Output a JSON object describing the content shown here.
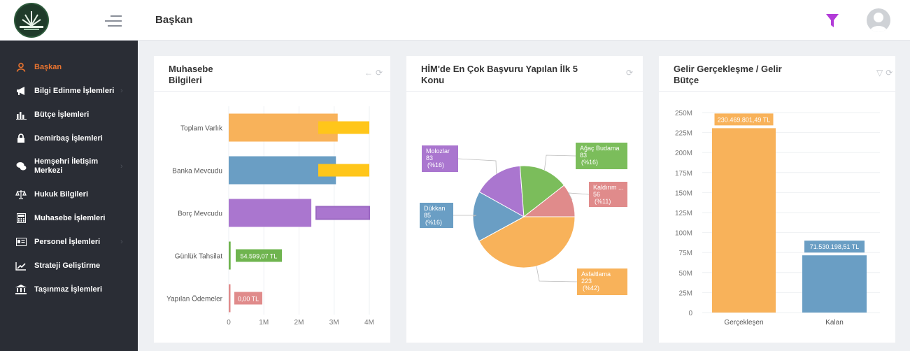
{
  "header": {
    "title": "Başkan"
  },
  "sidebar": {
    "items": [
      {
        "label": "Başkan",
        "icon": "user-icon"
      },
      {
        "label": "Bilgi Edinme İşlemleri",
        "icon": "megaphone-icon"
      },
      {
        "label": "Bütçe İşlemleri",
        "icon": "bar-chart-icon"
      },
      {
        "label": "Demirbaş İşlemleri",
        "icon": "lock-icon"
      },
      {
        "label": "Hemşehri İletişim Merkezi",
        "icon": "chat-icon"
      },
      {
        "label": "Hukuk Bilgileri",
        "icon": "scale-icon"
      },
      {
        "label": "Muhasebe İşlemleri",
        "icon": "calculator-icon"
      },
      {
        "label": "Personel İşlemleri",
        "icon": "id-card-icon"
      },
      {
        "label": "Strateji Geliştirme",
        "icon": "line-chart-icon"
      },
      {
        "label": "Taşınmaz İşlemleri",
        "icon": "bank-icon"
      }
    ]
  },
  "cards": {
    "accounting": {
      "title_line1": "Muhasebe",
      "title_line2": "Bilgileri"
    },
    "applications": {
      "title_line1": "HİM'de En Çok Başvuru Yapılan İlk 5",
      "title_line2": "Konu"
    },
    "revenue": {
      "title_line1": "Gelir Gerçekleşme / Gelir",
      "title_line2": "Bütçe"
    }
  },
  "colors": {
    "accent": "#e8732f",
    "sidebar_bg": "#2a2d35",
    "filter": "#b23bd8"
  },
  "chart_data": [
    {
      "type": "bar",
      "orientation": "horizontal",
      "categories": [
        "Toplam Varlık",
        "Banka Mevcudu",
        "Borç Mevcudu",
        "Günlük Tahsilat",
        "Yapılan Ödemeler"
      ],
      "values": [
        3100000,
        3050000,
        2350000,
        54599.07,
        0
      ],
      "colors": [
        "#f8b25a",
        "#6a9ec4",
        "#aa76cf",
        "#6fb44f",
        "#e08b8b"
      ],
      "data_labels": [
        "",
        "",
        "",
        "54.599,07 TL",
        "0,00 TL"
      ],
      "xticks": [
        "0",
        "1M",
        "2M",
        "3M",
        "4M"
      ],
      "xlim": [
        0,
        4000000
      ]
    },
    {
      "type": "pie",
      "slices": [
        {
          "label": "Asfaltlama",
          "value": 223,
          "pct": "(%42)",
          "color": "#f8b25a"
        },
        {
          "label": "Dükkan",
          "value": 85,
          "pct": "(%16)",
          "color": "#6a9ec4"
        },
        {
          "label": "Molozlar",
          "value": 83,
          "pct": "(%16)",
          "color": "#aa76cf"
        },
        {
          "label": "Ağaç Budama",
          "value": 83,
          "pct": "(%16)",
          "color": "#7bbd5b"
        },
        {
          "label": "Kaldırım ...",
          "value": 56,
          "pct": "(%11)",
          "color": "#e08b8b"
        }
      ]
    },
    {
      "type": "bar",
      "categories": [
        "Gerçekleşen",
        "Kalan"
      ],
      "values": [
        230469801.49,
        71530198.51
      ],
      "colors": [
        "#f8b25a",
        "#6a9ec4"
      ],
      "data_labels": [
        "230.469.801,49 TL",
        "71.530.198,51 TL"
      ],
      "yticks": [
        "0",
        "25M",
        "50M",
        "75M",
        "100M",
        "125M",
        "150M",
        "175M",
        "200M",
        "225M",
        "250M"
      ],
      "ylim": [
        0,
        250000000
      ]
    }
  ]
}
